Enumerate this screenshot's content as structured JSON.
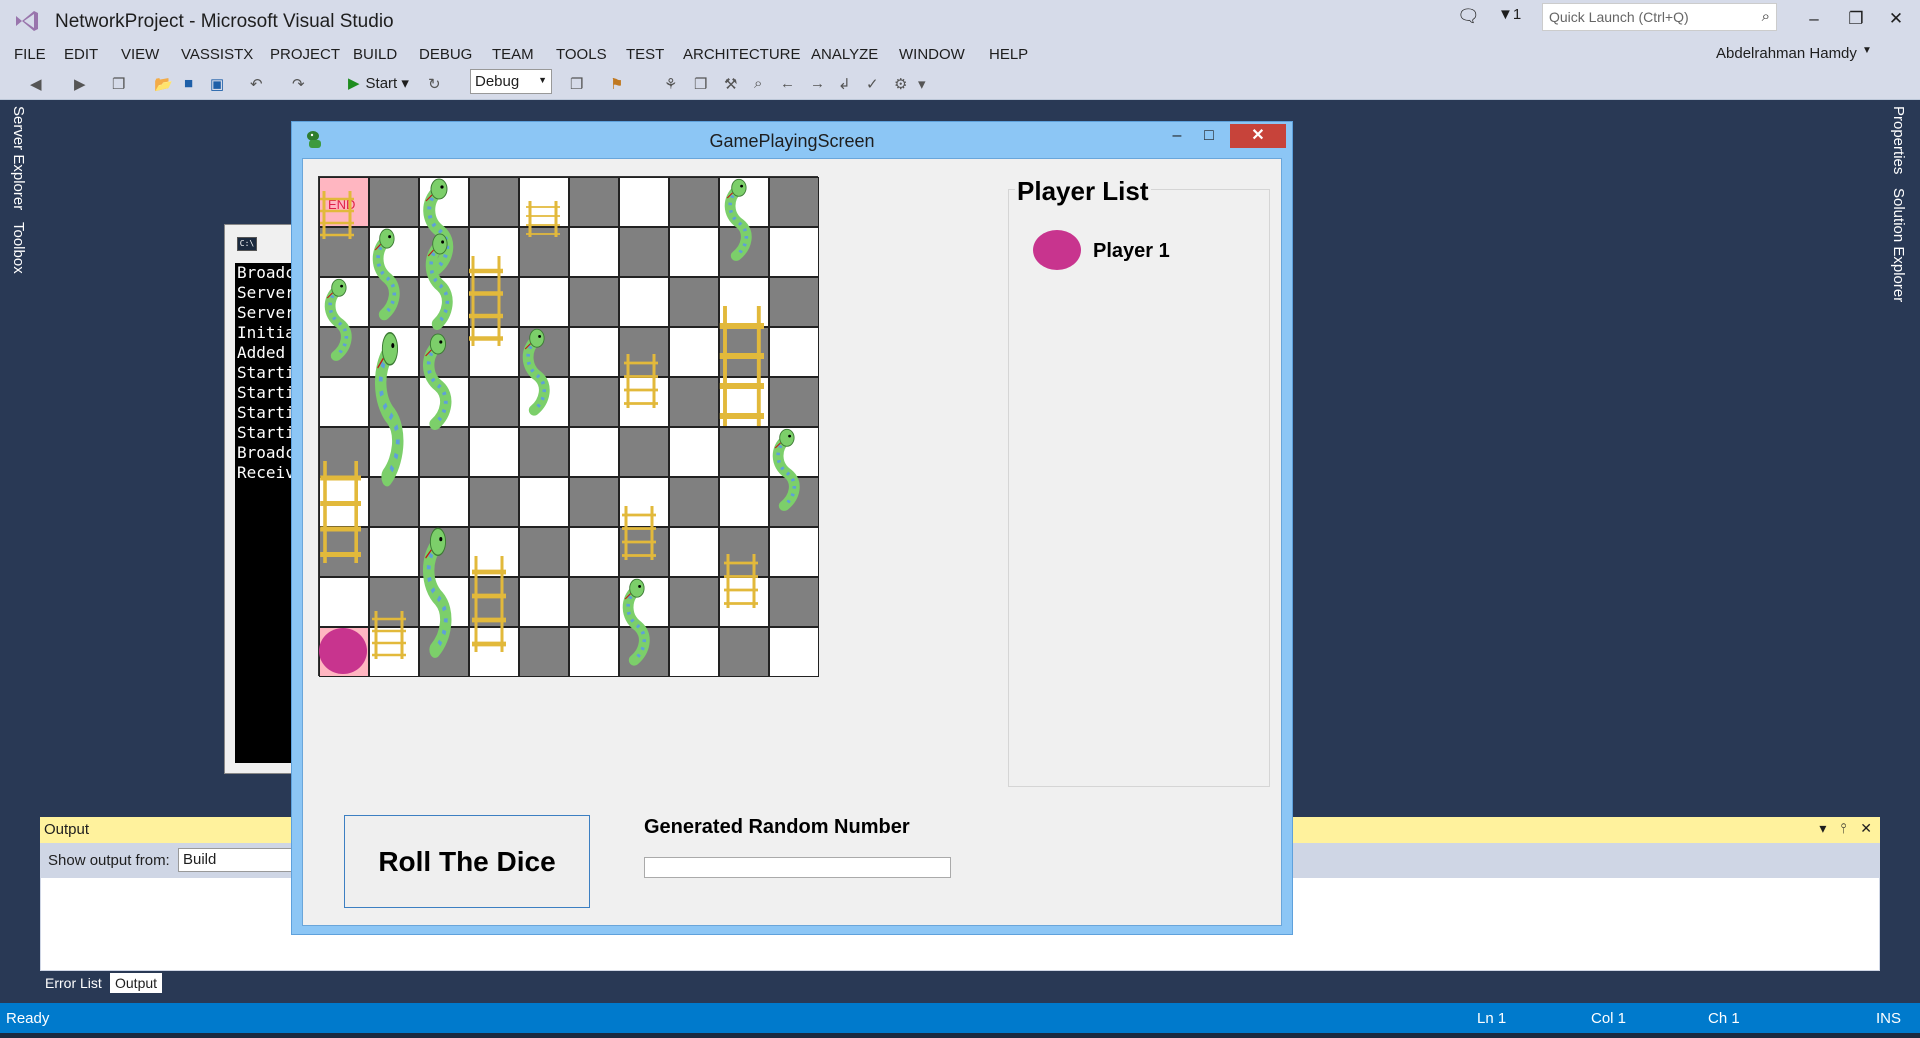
{
  "vs": {
    "title": "NetworkProject - Microsoft Visual Studio",
    "notification_count": "1",
    "quick_launch_placeholder": "Quick Launch (Ctrl+Q)",
    "user": "Abdelrahman Hamdy",
    "menu": [
      "FILE",
      "EDIT",
      "VIEW",
      "VASSISTX",
      "PROJECT",
      "BUILD",
      "DEBUG",
      "TEAM",
      "TOOLS",
      "TEST",
      "ARCHITECTURE",
      "ANALYZE",
      "WINDOW",
      "HELP"
    ],
    "toolbar": {
      "start_label": "Start",
      "config": "Debug"
    },
    "left_tabs": [
      "Server Explorer",
      "Toolbox"
    ],
    "right_tabs": [
      "Properties",
      "Solution Explorer"
    ]
  },
  "console": {
    "lines": [
      "Broadc",
      "Server",
      "Server",
      "Initia",
      "Added ",
      "Starti",
      "Starti",
      "Starti",
      "Starti",
      "Broadc",
      "Receiv"
    ]
  },
  "output": {
    "title": "Output",
    "from_label": "Show output from:",
    "from_value": "Build",
    "tabs": [
      "Error List",
      "Output"
    ]
  },
  "status": {
    "ready": "Ready",
    "ln": "Ln 1",
    "col": "Col 1",
    "ch": "Ch 1",
    "mode": "INS"
  },
  "game": {
    "window_title": "GamePlayingScreen",
    "end_label": "END",
    "player_list_title": "Player List",
    "players": [
      {
        "name": "Player 1",
        "color": "#c8348e"
      }
    ],
    "roll_button": "Roll The Dice",
    "random_label": "Generated Random Number",
    "random_value": "",
    "colors": {
      "dark_cell": "#808080",
      "light_cell": "#ffffff",
      "start_end": "#ffb6c1",
      "ladder": "#e2b93b",
      "snake": "#7ccf6a",
      "snake_stripe": "#5fa0d8"
    }
  }
}
